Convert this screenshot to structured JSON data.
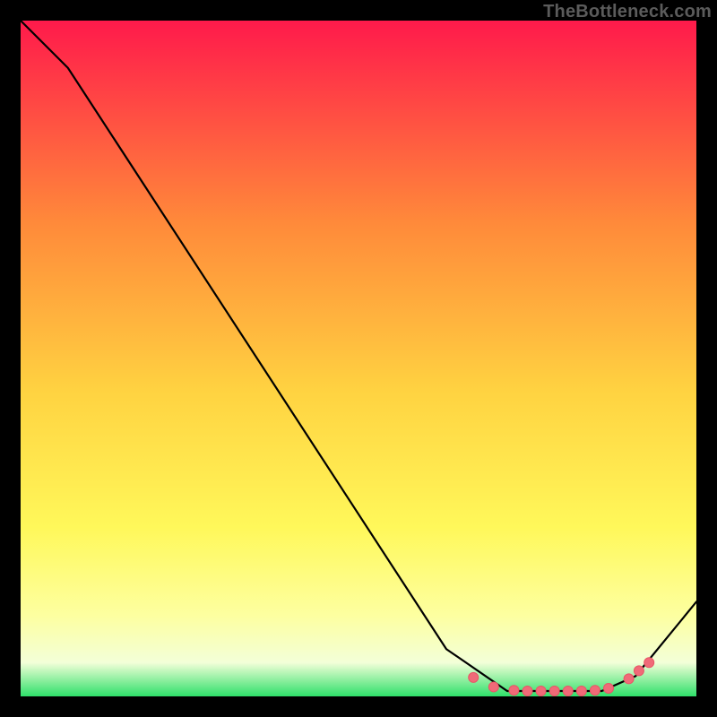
{
  "watermark": "TheBottleneck.com",
  "colors": {
    "gradient_top": "#ff1a4b",
    "gradient_mid_upper": "#ff8a3a",
    "gradient_mid": "#ffd341",
    "gradient_mid_lower": "#fff85a",
    "gradient_low": "#fdffa0",
    "gradient_pale": "#f3ffd8",
    "gradient_bottom": "#2fe06a",
    "curve": "#000000",
    "marker_fill": "#f06a78",
    "marker_stroke": "#e85566"
  },
  "chart_data": {
    "type": "line",
    "title": "",
    "xlabel": "",
    "ylabel": "",
    "xlim": [
      0,
      100
    ],
    "ylim": [
      0,
      100
    ],
    "curve": [
      {
        "x": 0,
        "y": 100
      },
      {
        "x": 7,
        "y": 93
      },
      {
        "x": 63,
        "y": 7
      },
      {
        "x": 72,
        "y": 0.8
      },
      {
        "x": 86,
        "y": 0.8
      },
      {
        "x": 91,
        "y": 3
      },
      {
        "x": 100,
        "y": 14
      }
    ],
    "markers": [
      {
        "x": 67,
        "y": 2.8
      },
      {
        "x": 70,
        "y": 1.4
      },
      {
        "x": 73,
        "y": 0.9
      },
      {
        "x": 75,
        "y": 0.8
      },
      {
        "x": 77,
        "y": 0.8
      },
      {
        "x": 79,
        "y": 0.8
      },
      {
        "x": 81,
        "y": 0.8
      },
      {
        "x": 83,
        "y": 0.8
      },
      {
        "x": 85,
        "y": 0.9
      },
      {
        "x": 87,
        "y": 1.2
      },
      {
        "x": 90,
        "y": 2.6
      },
      {
        "x": 91.5,
        "y": 3.8
      },
      {
        "x": 93,
        "y": 5.0
      }
    ]
  }
}
